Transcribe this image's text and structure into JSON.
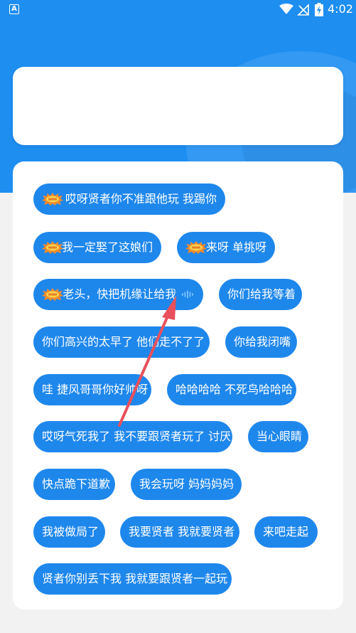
{
  "status_bar": {
    "time": "4:02",
    "app_icon_letter": "A",
    "icons": [
      "wifi-icon",
      "signal-off-icon",
      "battery-charging-icon"
    ]
  },
  "colors": {
    "primary": "#1e8ef1",
    "button": "#1e87ec",
    "background": "#f2f2f2",
    "arrow": "#e8505b"
  },
  "phrases": [
    {
      "text": "哎呀贤者你不准跟他玩  我踢你",
      "new": true
    },
    {
      "text": "我一定娶了这娘们",
      "new": true
    },
    {
      "text": "来呀 单挑呀",
      "new": true
    },
    {
      "text": "老头，快把机缘让给我",
      "new": true,
      "playing": true
    },
    {
      "text": "你们给我等着",
      "new": false
    },
    {
      "text": "你们高兴的太早了  他们走不了了",
      "new": false
    },
    {
      "text": "你给我闭嘴",
      "new": false
    },
    {
      "text": "哇 捷风哥哥你好帅呀",
      "new": false
    },
    {
      "text": "哈哈哈哈 不死鸟哈哈哈",
      "new": false
    },
    {
      "text": "哎呀气死我了 我不要跟贤者玩了 讨厌",
      "new": false
    },
    {
      "text": "当心眼睛",
      "new": false
    },
    {
      "text": "快点跪下道歉",
      "new": false
    },
    {
      "text": "我会玩呀  妈妈妈妈",
      "new": false
    },
    {
      "text": "我被做局了",
      "new": false
    },
    {
      "text": "我要贤者 我就要贤者",
      "new": false
    },
    {
      "text": "来吧走起",
      "new": false
    },
    {
      "text": "贤者你别丢下我  我就要跟贤者一起玩",
      "new": false
    }
  ]
}
